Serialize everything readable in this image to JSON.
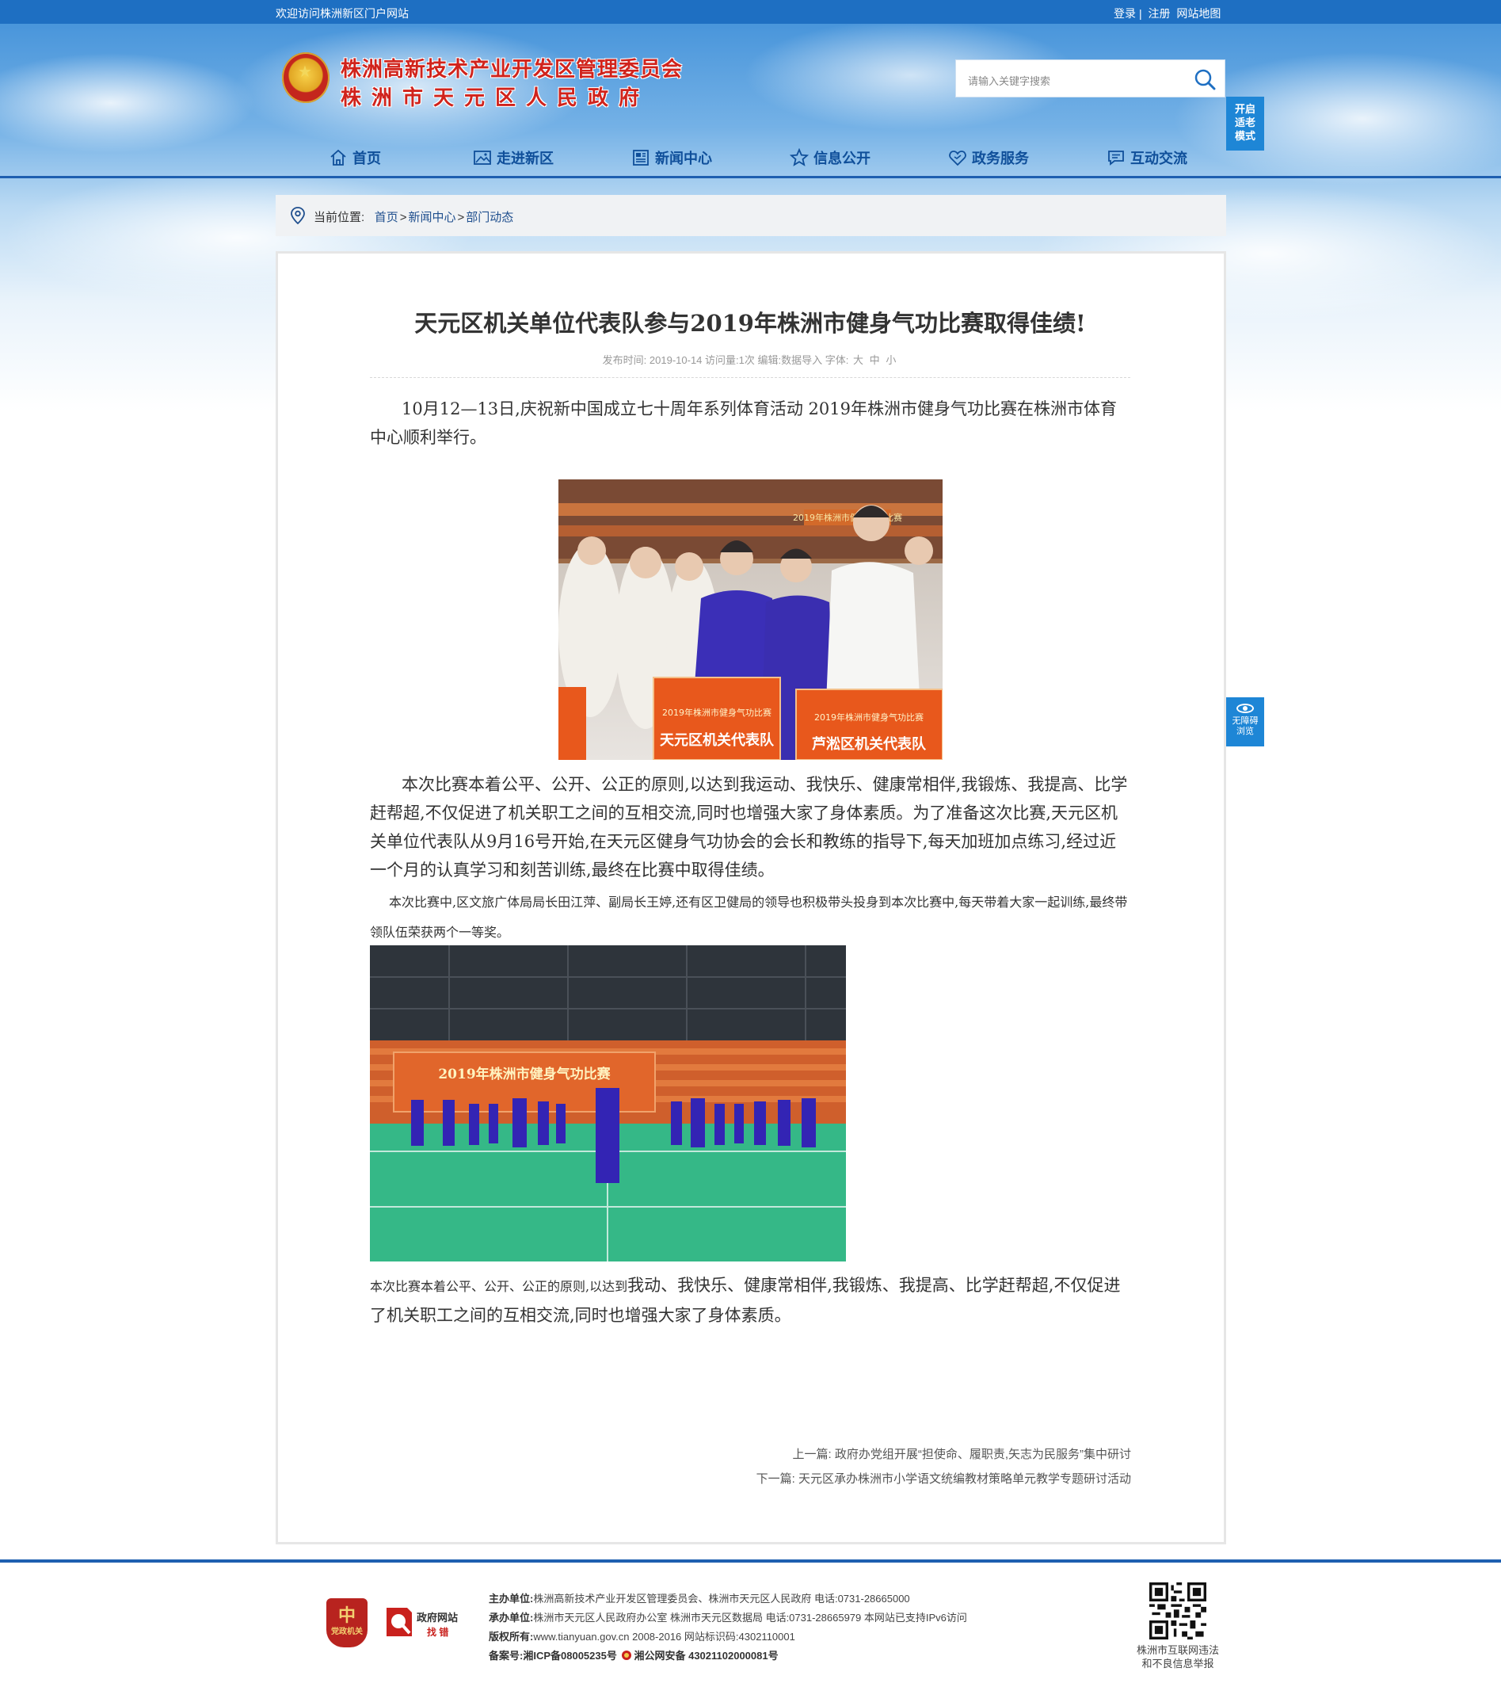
{
  "topbar": {
    "welcome": "欢迎访问株洲新区门户网站",
    "login": "登录",
    "sep": "|",
    "register": "注册",
    "sitemap": "网站地图"
  },
  "header": {
    "title_line1": "株洲高新技术产业开发区管理委员会",
    "title_line2": "株洲市天元区人民政府",
    "search_placeholder": "请输入关键字搜索",
    "old_mode": [
      "开启",
      "适老",
      "模式"
    ]
  },
  "nav": {
    "items": [
      {
        "label": "首页",
        "icon": "home-icon"
      },
      {
        "label": "走进新区",
        "icon": "picture-icon"
      },
      {
        "label": "新闻中心",
        "icon": "news-icon"
      },
      {
        "label": "信息公开",
        "icon": "star-icon"
      },
      {
        "label": "政务服务",
        "icon": "heart-icon"
      },
      {
        "label": "互动交流",
        "icon": "chat-icon"
      }
    ]
  },
  "breadcrumb": {
    "label": "当前位置:",
    "items": [
      "首页",
      "新闻中心",
      "部门动态"
    ],
    "sep": ">"
  },
  "article": {
    "title": "天元区机关单位代表队参与2019年株洲市健身气功比赛取得佳绩!",
    "meta": {
      "publish_label": "发布时间:",
      "publish_date": "2019-10-14",
      "views_label": "访问量:",
      "views": "1次",
      "editor_label": "编辑:",
      "editor": "数据导入",
      "font_label": "字体:",
      "font_large": "大",
      "font_medium": "中",
      "font_small": "小"
    },
    "p1": "10月12—13日,庆祝新中国成立七十周年系列体育活动 2019年株洲市健身气功比赛在株洲市体育中心顺利举行。",
    "p2": "本次比赛本着公平、公开、公正的原则,以达到我运动、我快乐、健康常相伴,我锻炼、我提高、比学赶帮超,不仅促进了机关职工之间的互相交流,同时也增强大家了身体素质。为了准备这次比赛,天元区机关单位代表队从9月16号开始,在天元区健身气功协会的会长和教练的指导下,每天加班加点练习,经过近一个月的认真学习和刻苦训练,最终在比赛中取得佳绩。",
    "p3": "本次比赛中,区文旅广体局局长田江萍、副局长王婷,还有区卫健局的领导也积极带头投身到本次比赛中,每天带着大家一起训练,最终带领队伍荣获两个一等奖。",
    "p4_small": "本次比赛本着公平、公开、公正的原则,以达到",
    "p4_big": "我动、我快乐、健康常相伴,我锻炼、我提高、比学赶帮超,不仅促进了机关职工之间的互相交流,同时也增强大家了身体素质。",
    "photo1": {
      "banner_top": "2019年株洲市健身气功比赛",
      "sign_left": "天元区机关代表队",
      "sign_right": "芦淞区机关代表队"
    },
    "photo2": {
      "banner": "2019年株洲市健身气功比赛"
    },
    "prev_label": "上一篇:",
    "prev_title": "政府办党组开展“担使命、履职责,矢志为民服务”集中研讨",
    "next_label": "下一篇:",
    "next_title": "天元区承办株洲市小学语文统编教材策略单元教学专题研讨活动"
  },
  "side": {
    "accessibility": [
      "无障碍",
      "浏览"
    ]
  },
  "footer": {
    "badge1_top": "党政机关",
    "badge1_char": "中",
    "badge2_line1": "政府网站",
    "badge2_line2": "找 错",
    "host_label": "主办单位:",
    "host": "株洲高新技术产业开发区管理委员会、株洲市天元区人民政府 电话:0731-28665000",
    "undertake_label": "承办单位:",
    "undertake": "株洲市天元区人民政府办公室 株洲市天元区数据局 电话:0731-28665979 本网站已支持IPv6访问",
    "copyright_label": "版权所有:",
    "copyright": "www.tianyuan.gov.cn 2008-2016 网站标识码:4302110001",
    "icp_label": "备案号:",
    "icp": "湘ICP备08005235号",
    "police": "湘公网安备 43021102000081号",
    "qr_caption_line1": "株洲市互联网违法",
    "qr_caption_line2": "和不良信息举报"
  },
  "colors": {
    "topbar": "#1e6fc2",
    "nav_text": "#0f4f9a",
    "title_red": "#d0231c",
    "accent_blue": "#1e86d6"
  }
}
